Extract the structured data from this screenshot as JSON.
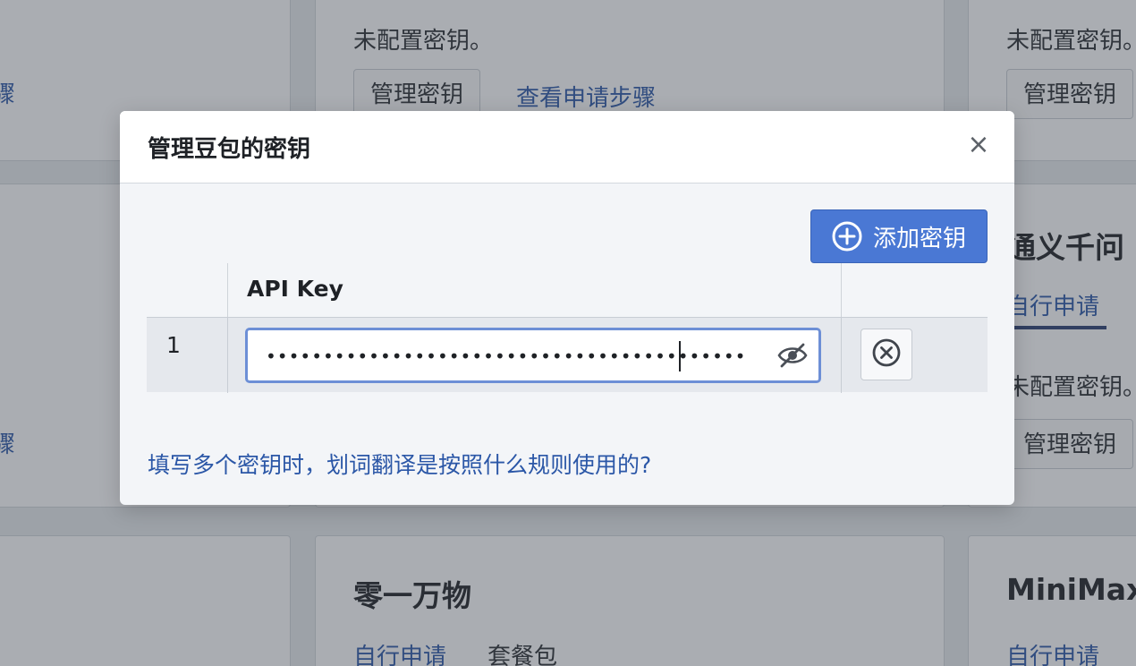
{
  "background": {
    "top_mid": {
      "status": "未配置密钥。",
      "manage_btn": "管理密钥",
      "steps_link": "查看申请步骤"
    },
    "top_right": {
      "status": "未配置密钥。",
      "manage_btn": "管理密钥"
    },
    "left_fragment_1": "骤",
    "left_fragment_2": "骤",
    "right_mid": {
      "title": "通义千问",
      "tab_self": "自行申请",
      "status": "未配置密钥。",
      "manage_btn": "管理密钥"
    },
    "bottom_mid": {
      "title": "零一万物",
      "tab_self": "自行申请",
      "tab_package": "套餐包"
    },
    "bottom_right": {
      "title": "MiniMax",
      "tab_self": "自行申请"
    }
  },
  "modal": {
    "title": "管理豆包的密钥",
    "close": "×",
    "add_button": "添加密钥",
    "table": {
      "header_key": "API Key",
      "rows": [
        {
          "index": "1",
          "masked_value": "••••••••••••••••••••••••••••••••••••••••••"
        }
      ]
    },
    "help_link": "填写多个密钥时，划词翻译是按照什么规则使用的?"
  },
  "colors": {
    "accent": "#4a78d4",
    "link": "#2b57a7",
    "input_focus": "#6d8fd6"
  },
  "icons": {
    "add": "plus-circle-icon",
    "visibility": "eye-off-icon",
    "delete": "x-circle-icon",
    "close": "close-icon"
  }
}
